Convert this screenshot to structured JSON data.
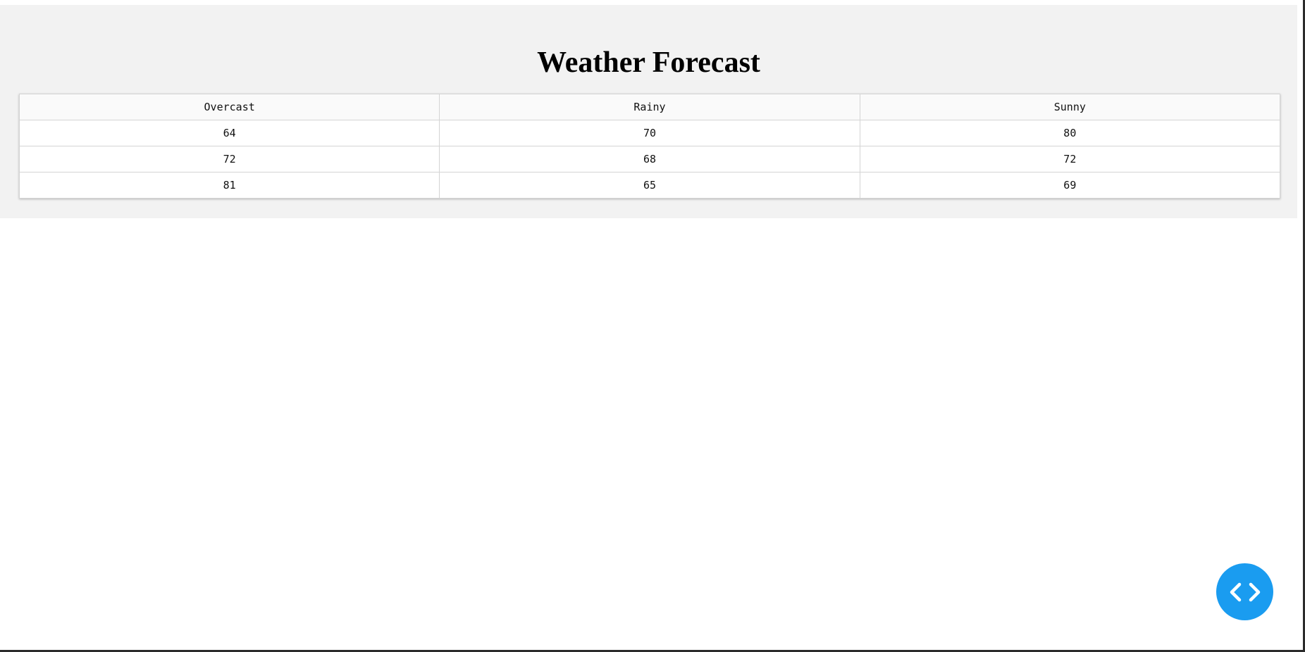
{
  "page": {
    "title": "Weather Forecast"
  },
  "table": {
    "headers": [
      "Overcast",
      "Rainy",
      "Sunny"
    ],
    "rows": [
      [
        "64",
        "70",
        "80"
      ],
      [
        "72",
        "68",
        "72"
      ],
      [
        "81",
        "65",
        "69"
      ]
    ]
  },
  "fab": {
    "icon": "code-icon",
    "color": "#1a9cf0"
  }
}
